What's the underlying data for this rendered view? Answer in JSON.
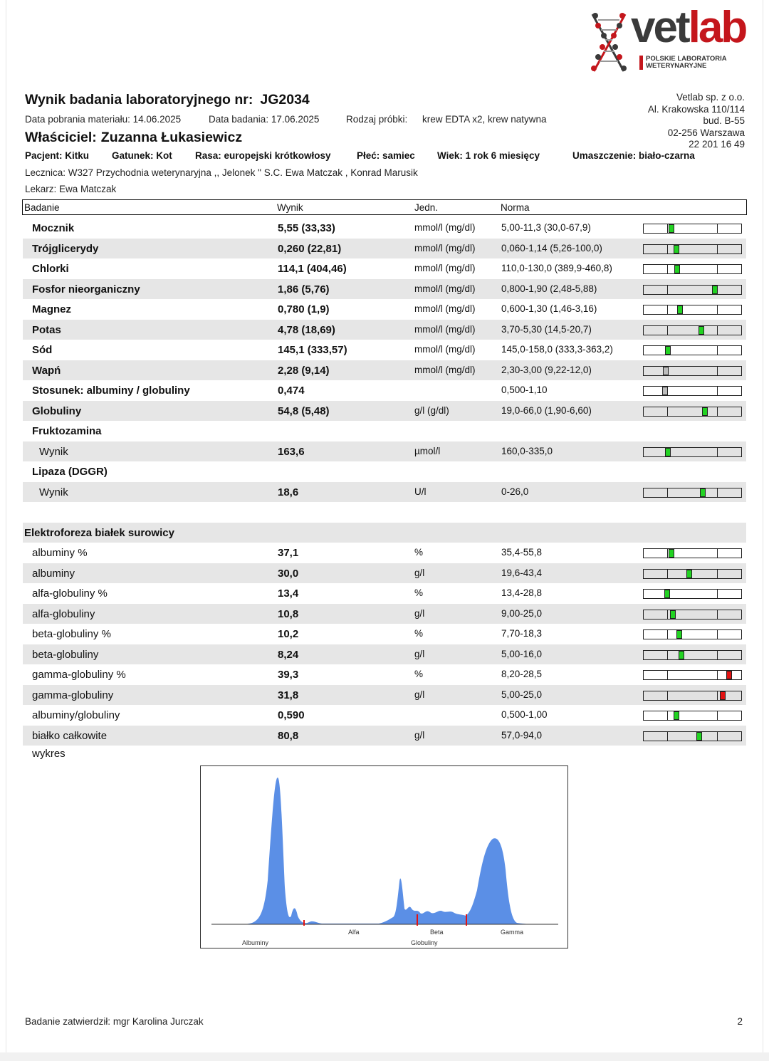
{
  "logo": {
    "vet": "vet",
    "lab": "lab",
    "sub_line1": "POLSKIE LABORATORIA",
    "sub_line2": "WETERYNARYJNE"
  },
  "header": {
    "title_label": "Wynik badania laboratoryjnego nr:",
    "title_number": "JG2034",
    "sample_date": "Data pobrania materiału: 14.06.2025",
    "test_date": "Data badania: 17.06.2025",
    "sample_type_label": "Rodzaj próbki:",
    "sample_type": "krew EDTA x2, krew natywna",
    "owner_label": "Właściciel:",
    "owner_name": "Zuzanna Łukasiewicz"
  },
  "lab_address": {
    "line1": "Vetlab sp. z o.o.",
    "line2": "Al. Krakowska 110/114",
    "line3": "bud. B-55",
    "line4": "02-256 Warszawa",
    "line5": "22 201 16 49"
  },
  "patient": {
    "name": "Pacjent: Kitku",
    "species": "Gatunek: Kot",
    "breed": "Rasa: europejski krótkowłosy",
    "sex": "Płeć: samiec",
    "age": "Wiek: 1 rok 6 miesięcy",
    "coat": "Umaszczenie:  biało-czarna"
  },
  "clinic": "Lecznica:  W327 Przychodnia weterynaryjna ,, Jelonek \" S.C. Ewa Matczak , Konrad Marusik",
  "doctor": "Lekarz: Ewa Matczak",
  "table_header": {
    "test": "Badanie",
    "result": "Wynik",
    "unit": "Jedn.",
    "norm": "Norma"
  },
  "rows": [
    {
      "name": "Mocznik",
      "value": "5,55 (33,33)",
      "unit": "mmol/l (mg/dl)",
      "norm": "5,00-11,3 (30,0-67,9)",
      "gauge": 0.08,
      "status": "ok",
      "style": "bold"
    },
    {
      "name": "Trójglicerydy",
      "value": "0,260 (22,81)",
      "unit": "mmol/l (mg/dl)",
      "norm": "0,060-1,14 (5,26-100,0)",
      "gauge": 0.18,
      "status": "ok",
      "style": "bold"
    },
    {
      "name": "Chlorki",
      "value": "114,1 (404,46)",
      "unit": "mmol/l (mg/dl)",
      "norm": "110,0-130,0 (389,9-460,8)",
      "gauge": 0.2,
      "status": "ok",
      "style": "bold"
    },
    {
      "name": "Fosfor nieorganiczny",
      "value": "1,86 (5,76)",
      "unit": "mmol/l (mg/dl)",
      "norm": "0,800-1,90 (2,48-5,88)",
      "gauge": 0.96,
      "status": "ok",
      "style": "bold"
    },
    {
      "name": "Magnez",
      "value": "0,780 (1,9)",
      "unit": "mmol/l (mg/dl)",
      "norm": "0,600-1,30 (1,46-3,16)",
      "gauge": 0.26,
      "status": "ok",
      "style": "bold"
    },
    {
      "name": "Potas",
      "value": "4,78 (18,69)",
      "unit": "mmol/l (mg/dl)",
      "norm": "3,70-5,30 (14,5-20,7)",
      "gauge": 0.68,
      "status": "ok",
      "style": "bold"
    },
    {
      "name": "Sód",
      "value": "145,1 (333,57)",
      "unit": "mmol/l (mg/dl)",
      "norm": "145,0-158,0 (333,3-363,2)",
      "gauge": 0.01,
      "status": "ok",
      "style": "bold"
    },
    {
      "name": "Wapń",
      "value": "2,28 (9,14)",
      "unit": "mmol/l (mg/dl)",
      "norm": "2,30-3,00 (9,22-12,0)",
      "gauge": -0.03,
      "status": "low",
      "style": "bold"
    },
    {
      "name": "Stosunek: albuminy / globuliny",
      "value": "0,474",
      "unit": "",
      "norm": "0,500-1,10",
      "gauge": -0.04,
      "status": "low",
      "style": "bold"
    },
    {
      "name": "Globuliny",
      "value": "54,8 (5,48)",
      "unit": "g/l (g/dl)",
      "norm": "19,0-66,0 (1,90-6,60)",
      "gauge": 0.76,
      "status": "ok",
      "style": "bold"
    },
    {
      "name": "Fruktozamina",
      "value": "",
      "unit": "",
      "norm": "",
      "gauge": null,
      "status": "",
      "style": "bold"
    },
    {
      "name": "Wynik",
      "value": "163,6",
      "unit": "µmol/l",
      "norm": "160,0-335,0",
      "gauge": 0.02,
      "status": "ok",
      "style": "sub"
    },
    {
      "name": "Lipaza (DGGR)",
      "value": "",
      "unit": "",
      "norm": "",
      "gauge": null,
      "status": "",
      "style": "bold"
    },
    {
      "name": "Wynik",
      "value": "18,6",
      "unit": "U/l",
      "norm": "0-26,0",
      "gauge": 0.72,
      "status": "ok",
      "style": "sub"
    },
    {
      "name": "",
      "value": "",
      "unit": "",
      "norm": "",
      "gauge": null,
      "status": "",
      "style": "blank"
    },
    {
      "name": "Elektroforeza białek surowicy",
      "value": "",
      "unit": "",
      "norm": "",
      "gauge": null,
      "status": "",
      "style": "section"
    },
    {
      "name": "albuminy %",
      "value": "37,1",
      "unit": "%",
      "norm": "35,4-55,8",
      "gauge": 0.08,
      "status": "ok",
      "style": "plain"
    },
    {
      "name": "albuminy",
      "value": "30,0",
      "unit": "g/l",
      "norm": "19,6-43,4",
      "gauge": 0.44,
      "status": "ok",
      "style": "plain"
    },
    {
      "name": "alfa-globuliny %",
      "value": "13,4",
      "unit": "%",
      "norm": "13,4-28,8",
      "gauge": 0.0,
      "status": "ok",
      "style": "plain"
    },
    {
      "name": "alfa-globuliny",
      "value": "10,8",
      "unit": "g/l",
      "norm": "9,00-25,0",
      "gauge": 0.11,
      "status": "ok",
      "style": "plain"
    },
    {
      "name": "beta-globuliny %",
      "value": "10,2",
      "unit": "%",
      "norm": "7,70-18,3",
      "gauge": 0.24,
      "status": "ok",
      "style": "plain"
    },
    {
      "name": "beta-globuliny",
      "value": "8,24",
      "unit": "g/l",
      "norm": "5,00-16,0",
      "gauge": 0.29,
      "status": "ok",
      "style": "plain"
    },
    {
      "name": "gamma-globuliny %",
      "value": "39,3",
      "unit": "%",
      "norm": "8,20-28,5",
      "gauge": 1.24,
      "status": "high",
      "style": "plain"
    },
    {
      "name": "gamma-globuliny",
      "value": "31,8",
      "unit": "g/l",
      "norm": "5,00-25,0",
      "gauge": 1.12,
      "status": "high",
      "style": "plain"
    },
    {
      "name": "albuminy/globuliny",
      "value": "0,590",
      "unit": "",
      "norm": "0,500-1,00",
      "gauge": 0.18,
      "status": "ok",
      "style": "plain"
    },
    {
      "name": "białko całkowite",
      "value": "80,8",
      "unit": "g/l",
      "norm": "57,0-94,0",
      "gauge": 0.64,
      "status": "ok",
      "style": "plain"
    }
  ],
  "chart_title": "wykres",
  "chart_labels": {
    "albuminy": "Albuminy",
    "alfa": "Alfa",
    "beta": "Beta",
    "gamma": "Gamma",
    "globuliny": "Globuliny"
  },
  "colors": {
    "fill": "#5b8fe6",
    "marker_ok": "#22d322",
    "marker_high": "#e31212",
    "marker_low": "#bdbdbd",
    "brand_red": "#c4161c"
  },
  "footer": {
    "approved_by": "Badanie zatwierdził: mgr Karolina Jurczak",
    "page": "2"
  }
}
